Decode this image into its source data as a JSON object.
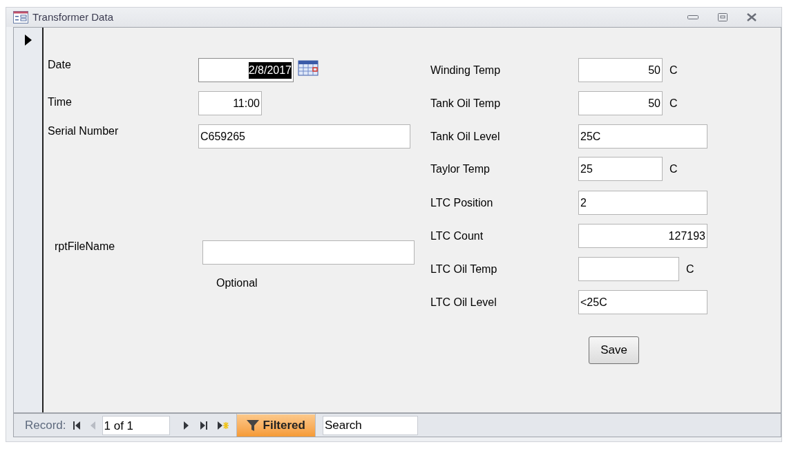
{
  "window": {
    "title": "Transformer Data"
  },
  "left_fields": [
    {
      "label": "Date",
      "value": "2/8/2017",
      "selected": true,
      "calendar": true
    },
    {
      "label": "Time",
      "value": "11:00",
      "selected": false
    },
    {
      "label": "Serial Number",
      "value": "C659265",
      "selected": false
    },
    {
      "label": "rptFileName",
      "selected": false,
      "note": "Optional"
    }
  ],
  "right_fields": [
    {
      "label": "Winding Temp",
      "value": "50",
      "unit": "C"
    },
    {
      "label": "Tank Oil Temp",
      "value": "50",
      "unit": "C"
    },
    {
      "label": "Tank Oil Level",
      "value": "25C"
    },
    {
      "label": "Taylor Temp",
      "value": "25",
      "unit": "C"
    },
    {
      "label": "LTC Position",
      "value": "2"
    },
    {
      "label": "LTC Count",
      "value": "127193"
    },
    {
      "label": "LTC Oil Temp",
      "unit": "C"
    },
    {
      "label": "LTC Oil Level",
      "value": "<25C"
    }
  ],
  "save_button": "Save",
  "navigation": {
    "label": "Record:",
    "buttons": [
      {
        "kind": "first",
        "disabled": false
      },
      {
        "kind": "prev",
        "disabled": true
      }
    ],
    "position": "1 of 1",
    "after": [
      {
        "kind": "next",
        "disabled": false
      },
      {
        "kind": "last",
        "disabled": false
      },
      {
        "kind": "new",
        "disabled": false
      }
    ],
    "filter": {
      "label": "Filtered",
      "on": true
    },
    "search": {
      "placeholder": "Search"
    }
  }
}
